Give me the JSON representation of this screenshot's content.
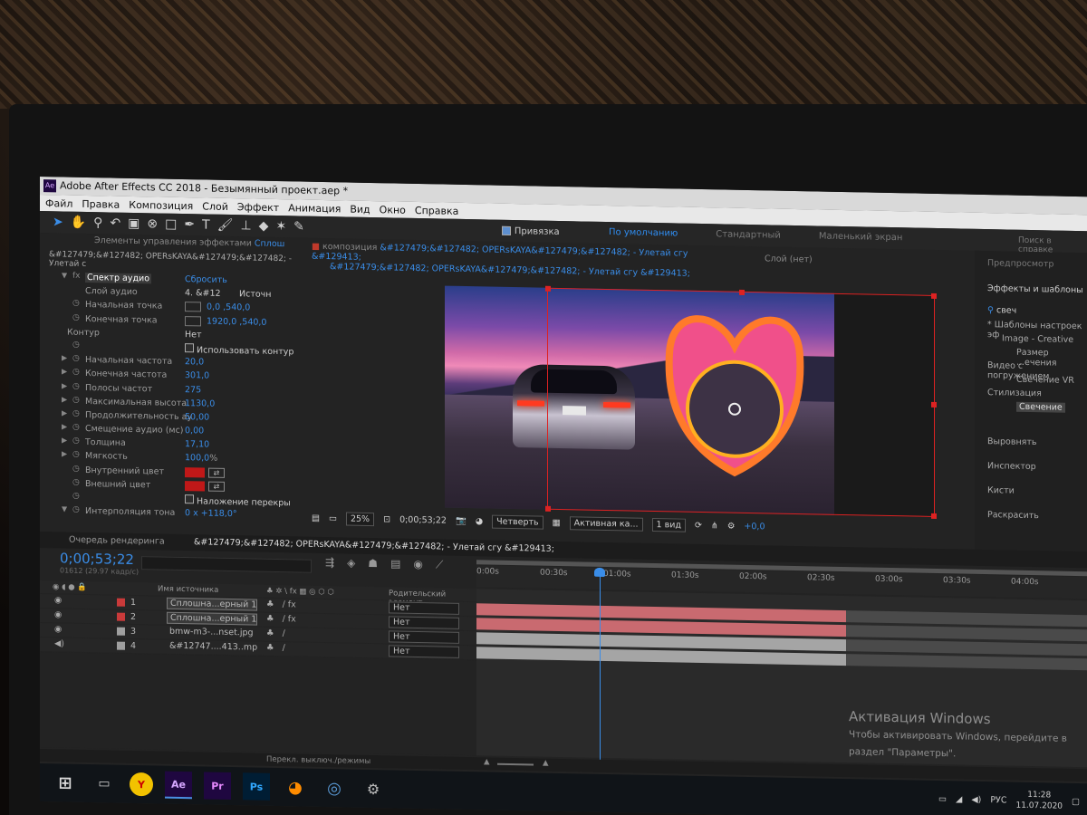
{
  "window": {
    "title": "Adobe After Effects CC 2018 - Безымянный проект.aep *"
  },
  "menu": [
    "Файл",
    "Правка",
    "Композиция",
    "Слой",
    "Эффект",
    "Анимация",
    "Вид",
    "Окно",
    "Справка"
  ],
  "toolbar": {
    "snap_label": "Привязка",
    "snap_checked": true
  },
  "workspaces": {
    "items": [
      "По умолчанию",
      "Стандартный",
      "Маленький экран"
    ],
    "active": "По умолчанию",
    "search": "Поиск в справке"
  },
  "effect_controls": {
    "tab_label": "Элементы управления эффектами",
    "tab_layer": "Сплош",
    "breadcrumb": "&#127479;&#127482; OPERsKAYA&#127479;&#127482; - Улетай с",
    "effect_name": "Спектр аудио",
    "reset_label": "Сбросить",
    "audio_layer": {
      "label": "Слой аудио",
      "value": "4. &#12",
      "source": "Источн"
    },
    "start_point": {
      "label": "Начальная точка",
      "value": "0,0 ,540,0"
    },
    "end_point": {
      "label": "Конечная точка",
      "value": "1920,0 ,540,0"
    },
    "path": {
      "label": "Контур",
      "value": "Нет"
    },
    "use_polar": "Использовать контур",
    "start_freq": {
      "label": "Начальная частота",
      "value": "20,0"
    },
    "end_freq": {
      "label": "Конечная частота",
      "value": "301,0"
    },
    "freq_bands": {
      "label": "Полосы частот",
      "value": "275"
    },
    "max_height": {
      "label": "Максимальная высота",
      "value": "1130,0"
    },
    "audio_duration": {
      "label": "Продолжительность ау",
      "value": "50,00"
    },
    "audio_offset": {
      "label": "Смещение аудио (мс)",
      "value": "0,00"
    },
    "thickness": {
      "label": "Толщина",
      "value": "17,10"
    },
    "softness": {
      "label": "Мягкость",
      "value": "100,0",
      "unit": "%"
    },
    "inside_color": {
      "label": "Внутренний цвет",
      "color": "#c01818"
    },
    "outside_color": {
      "label": "Внешний цвет",
      "color": "#c01818"
    },
    "blend_overlap": "Наложение перекры",
    "hue_interp": {
      "label": "Интерполяция тона",
      "value": "0 x +118,0°"
    }
  },
  "composition": {
    "tab_prefix": "композиция",
    "tab_name": "&#127479;&#127482; OPERsKAYA&#127479;&#127482; - Улетай сгу &#129413;",
    "breadcrumb": "&#127479;&#127482; OPERsKAYA&#127479;&#127482; - Улетай сгу &#129413;",
    "layer_tab": "Слой (нет)",
    "zoom": "25%",
    "timecode": "0;00;53;22",
    "resolution": "Четверть",
    "camera": "Активная ка...",
    "views": "1 вид",
    "exposure": "+0,0"
  },
  "right_panel": {
    "preview": "Предпросмотр",
    "effects_title": "Эффекты и шаблоны",
    "search": "свеч",
    "tree": [
      "* Шаблоны настроек эф",
      "Image - Creative",
      "Размер ...ечения",
      "Видео с погружением",
      "Свечение VR",
      "Стилизация",
      "Свечение"
    ],
    "panels": [
      "Выровнять",
      "Инспектор",
      "Кисти",
      "Раскрасить"
    ]
  },
  "timeline": {
    "render_queue_tab": "Очередь рендеринга",
    "comp_tab": "&#127479;&#127482; OPERsKAYA&#127479;&#127482; - Улетай сгу &#129413;",
    "timecode": "0;00;53;22",
    "fps": "01612 (29.97 кадр/с)",
    "col_source": "Имя источника",
    "col_parent": "Родительский элемент",
    "ruler": [
      "0:00s",
      "00:30s",
      "01:00s",
      "01:30s",
      "02:00s",
      "02:30s",
      "03:00s",
      "03:30s",
      "04:00s"
    ],
    "layers": [
      {
        "index": "1",
        "name": "Сплошна...ерный 1",
        "parent": "Нет",
        "color": "#c93a3a"
      },
      {
        "index": "2",
        "name": "Сплошна...ерный 1",
        "parent": "Нет",
        "color": "#c93a3a"
      },
      {
        "index": "3",
        "name": "bmw-m3-...nset.jpg",
        "parent": "Нет",
        "color": "#9f9f9f"
      },
      {
        "index": "4",
        "name": "&#12747....413..mp3",
        "parent": "Нет",
        "color": "#9f9f9f"
      }
    ],
    "bottom_label": "Перекл. выключ./режимы"
  },
  "activation": {
    "title": "Активация Windows",
    "line1": "Чтобы активировать Windows, перейдите в",
    "line2": "раздел \"Параметры\"."
  },
  "taskbar": {
    "apps": [
      "Ae",
      "Pr",
      "Ps"
    ],
    "lang": "РУС",
    "time": "11:28",
    "date": "11.07.2020"
  }
}
